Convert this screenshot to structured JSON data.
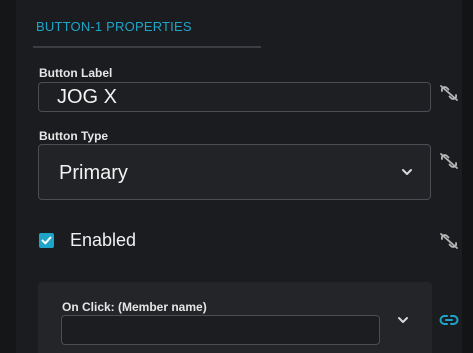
{
  "panel": {
    "title": "BUTTON-1 PROPERTIES",
    "fields": {
      "button_label": {
        "label": "Button Label",
        "value": "JOG X",
        "link_icon": "unlink-icon"
      },
      "button_type": {
        "label": "Button Type",
        "selected": "Primary",
        "link_icon": "unlink-icon"
      },
      "enabled": {
        "label": "Enabled",
        "checked": true,
        "link_icon": "unlink-icon"
      },
      "on_click": {
        "label": "On Click: (Member name)",
        "value": "",
        "link_icon": "link-icon"
      }
    }
  },
  "colors": {
    "accent": "#1fa4c9",
    "background": "#1a1c1f",
    "text": "#f0f0f0",
    "icon": "#b8b8b8"
  }
}
